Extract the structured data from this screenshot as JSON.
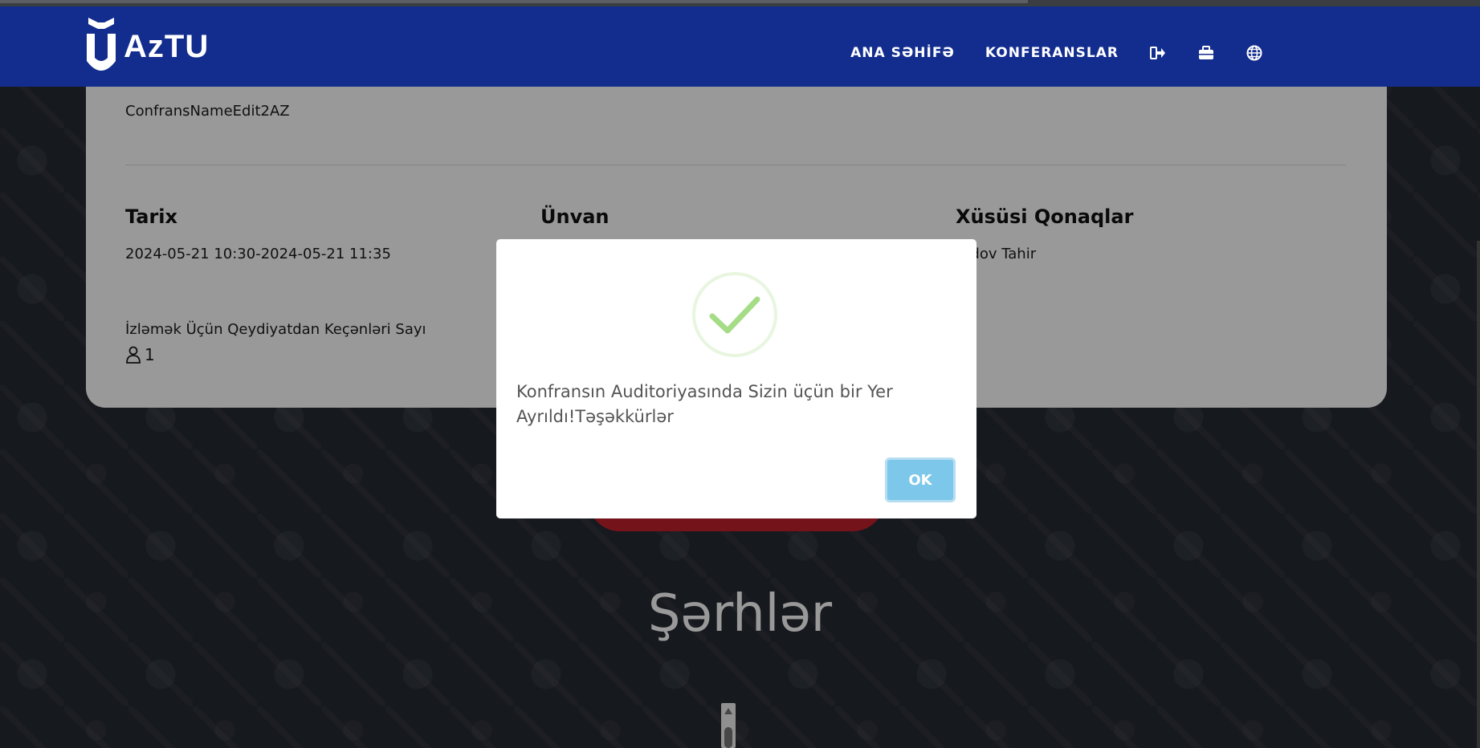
{
  "header": {
    "logo_text": "AzTU",
    "nav": {
      "home": "ANA SƏHİFƏ",
      "conferences": "KONFERANSLAR"
    },
    "icons": [
      "logout-icon",
      "briefcase-icon",
      "globe-icon"
    ]
  },
  "conference": {
    "name": "ConfransNameEdit2AZ",
    "date_title": "Tarix",
    "date_value": "2024-05-21 10:30-2024-05-21 11:35",
    "address_title": "Ünvan",
    "guests_title": "Xüsüsi Qonaqlar",
    "guests_value": "radov Tahir",
    "registered_label": "İzləmək Üçün Qeydiyatdan Keçənləri Sayı",
    "registered_count": "1"
  },
  "comments": {
    "title": "Şərhlər"
  },
  "modal": {
    "message": "Konfransın Auditoriyasında Sizin üçün bir Yer Ayrıldı!Təşəkkürlər",
    "ok_label": "OK"
  },
  "colors": {
    "header": "#132d8e",
    "ok_button": "#7cc7ea",
    "success_check": "#a5dc86",
    "action_button": "#c3212c"
  }
}
